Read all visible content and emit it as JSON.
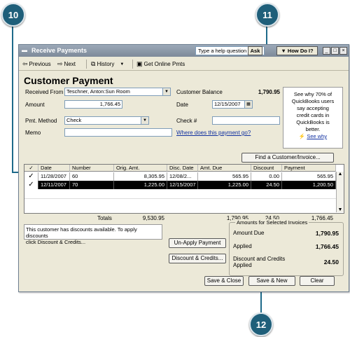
{
  "callouts": {
    "c10": "10",
    "c11": "11",
    "c12": "12"
  },
  "window": {
    "title": "Receive Payments",
    "help_placeholder": "Type a help question",
    "ask_label": "Ask",
    "howdo_label": "How Do I?",
    "btn_min": "_",
    "btn_max": "□",
    "btn_close": "×"
  },
  "toolbar": {
    "previous": "Previous",
    "next": "Next",
    "history": "History",
    "online": "Get Online Pmts"
  },
  "form": {
    "heading": "Customer Payment",
    "received_from_label": "Received From",
    "received_from_value": "Teschner, Anton:Sun Room",
    "customer_balance_label": "Customer Balance",
    "customer_balance_value": "1,790.95",
    "amount_label": "Amount",
    "amount_value": "1,766.45",
    "date_label": "Date",
    "date_value": "12/15/2007",
    "pmt_method_label": "Pmt. Method",
    "pmt_method_value": "Check",
    "check_label": "Check #",
    "check_value": "",
    "memo_label": "Memo",
    "memo_value": "",
    "where_link": "Where does this payment go?",
    "find_button": "Find a Customer/Invoice..."
  },
  "sidebox": {
    "text1": "See why 70% of",
    "text2": "QuickBooks users",
    "text3": "say accepting",
    "text4": "credit cards in",
    "text5": "QuickBooks is",
    "text6": "better.",
    "link": "See why"
  },
  "table": {
    "headers": {
      "check": "✓",
      "date": "Date",
      "number": "Number",
      "orig_amt": "Orig. Amt.",
      "disc_date": "Disc. Date",
      "amt_due": "Amt. Due",
      "discount": "Discount",
      "payment": "Payment"
    },
    "rows": [
      {
        "check": "✓",
        "date": "11/28/2007",
        "number": "60",
        "orig_amt": "8,305.95",
        "disc_date": "12/08/2...",
        "amt_due": "565.95",
        "discount": "0.00",
        "payment": "565.95"
      },
      {
        "check": "✓",
        "date": "12/11/2007",
        "number": "70",
        "orig_amt": "1,225.00",
        "disc_date": "12/15/2007",
        "amt_due": "1,225.00",
        "discount": "24.50",
        "payment": "1,200.50"
      }
    ],
    "totals_label": "Totals",
    "total_orig": "9,530.95",
    "total_due": "1,790.95",
    "total_discount": "24.50",
    "total_payment": "1,766.45"
  },
  "message": {
    "line1": "This customer has discounts available. To apply discounts",
    "line2": "click Discount & Credits..."
  },
  "amounts": {
    "caption": "Amounts for Selected Invoices",
    "amount_due_label": "Amount Due",
    "amount_due_value": "1,790.95",
    "applied_label": "Applied",
    "applied_value": "1,766.45",
    "disc_label_1": "Discount and Credits",
    "disc_label_2": "Applied",
    "disc_value": "24.50"
  },
  "buttons": {
    "unapply": "Un-Apply Payment",
    "discount": "Discount & Credits...",
    "save_close": "Save & Close",
    "save_new": "Save & New",
    "clear": "Clear"
  },
  "colors": {
    "callout": "#1f5f7a",
    "line": "#1e6a8a",
    "selected_row": "#000000"
  }
}
